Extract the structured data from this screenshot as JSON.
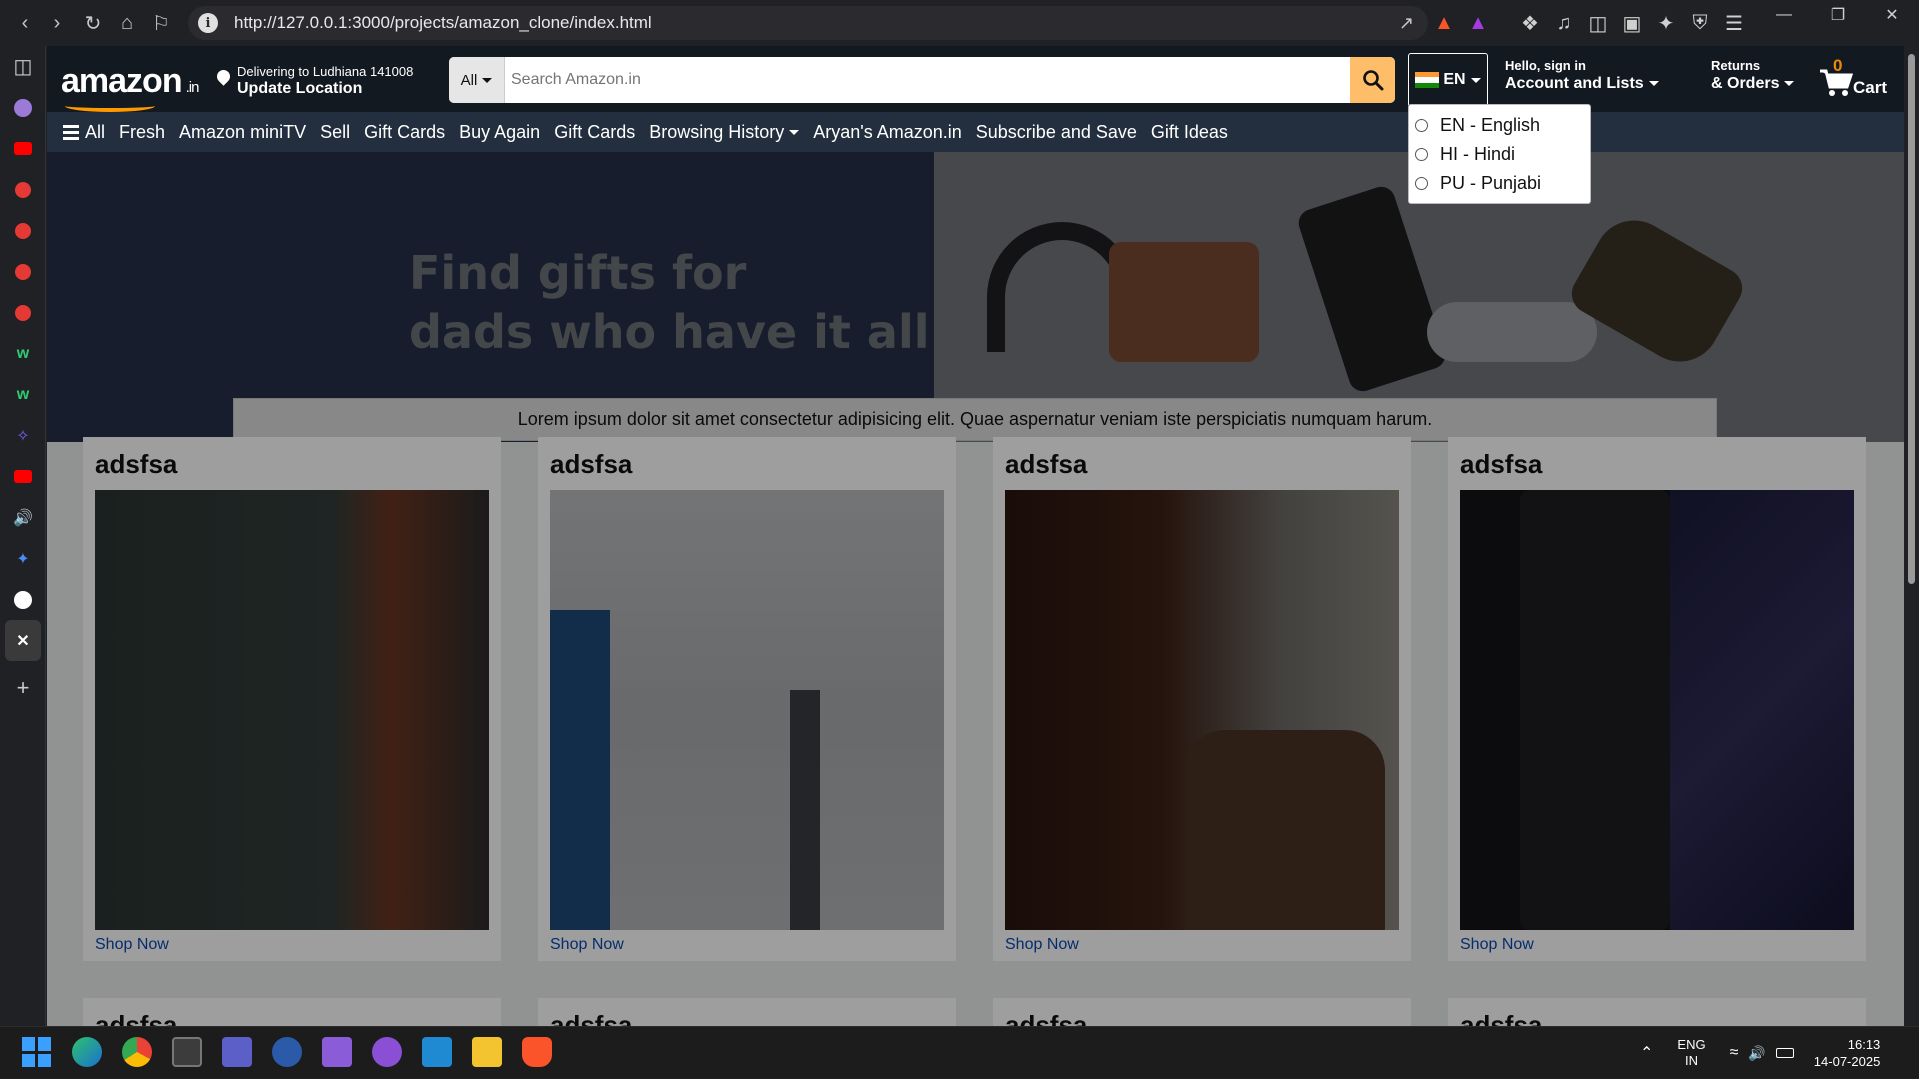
{
  "browser": {
    "url": "http://127.0.0.1:3000/projects/amazon_clone/index.html"
  },
  "header": {
    "logo_text": "amazon",
    "logo_suffix": ".in",
    "delivering_to": "Delivering to Ludhiana 141008",
    "update_location": "Update Location",
    "search_category": "All",
    "search_placeholder": "Search Amazon.in",
    "language_code": "EN",
    "account_greeting": "Hello, sign in",
    "account_label": "Account and Lists",
    "returns_label": "Returns",
    "orders_label": "& Orders",
    "cart_count": "0",
    "cart_label": "Cart"
  },
  "subnav": {
    "all": "All",
    "items": [
      "Fresh",
      "Amazon miniTV",
      "Sell",
      "Gift Cards",
      "Buy Again",
      "Gift Cards",
      "Browsing History",
      "Aryan's Amazon.in",
      "Subscribe and Save",
      "Gift Ideas"
    ]
  },
  "language_dropdown": {
    "options": [
      "EN - English",
      "HI - Hindi",
      "PU - Punjabi"
    ]
  },
  "hero": {
    "headline_line1": "Find gifts for",
    "headline_line2": "dads who have it all",
    "notice": "Lorem ipsum dolor sit amet consectetur adipisicing elit. Quae aspernatur veniam iste perspiciatis numquam harum."
  },
  "cards": [
    {
      "title": "adsfsa",
      "link": "Shop Now"
    },
    {
      "title": "adsfsa",
      "link": "Shop Now"
    },
    {
      "title": "adsfsa",
      "link": "Shop Now"
    },
    {
      "title": "adsfsa",
      "link": "Shop Now"
    }
  ],
  "cards_row2": [
    "adsfsa",
    "adsfsa",
    "adsfsa",
    "adsfsa"
  ],
  "taskbar": {
    "lang_line1": "ENG",
    "lang_line2": "IN",
    "time": "16:13",
    "date": "14-07-2025"
  },
  "colors": {
    "header_bg": "#131921",
    "subnav_bg": "#232f3e",
    "search_button": "#febd69",
    "cart_count": "#f08804",
    "link": "#0a48b1"
  }
}
